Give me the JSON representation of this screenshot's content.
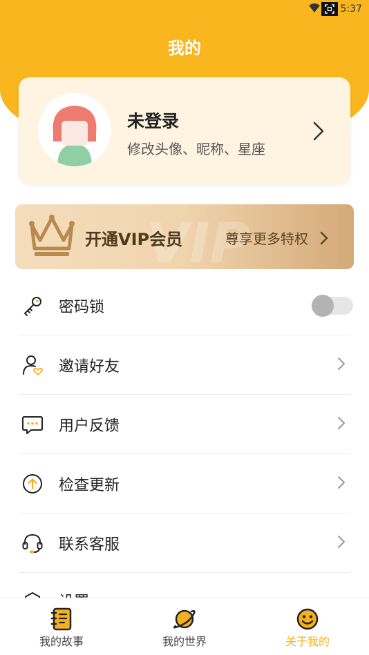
{
  "status_bar": {
    "time": "5:37",
    "icons": [
      "wifi-icon",
      "screenshot-icon"
    ]
  },
  "header": {
    "title": "我的",
    "background_color": "#FAB61E"
  },
  "profile": {
    "name": "未登录",
    "subtitle": "修改头像、昵称、星座",
    "icons": [
      "avatar-icon",
      "chevron-right-icon"
    ]
  },
  "vip": {
    "title": "开通VIP会员",
    "subtitle": "尊享更多特权",
    "watermark": "VIP",
    "icons": [
      "crown-icon",
      "chevron-right-icon"
    ]
  },
  "menu": {
    "items": [
      {
        "label": "密码锁",
        "icon": "key-icon",
        "control": "toggle",
        "toggle_on": false
      },
      {
        "label": "邀请好友",
        "icon": "invite-user-icon",
        "control": "chevron"
      },
      {
        "label": "用户反馈",
        "icon": "feedback-chat-icon",
        "control": "chevron"
      },
      {
        "label": "检查更新",
        "icon": "update-arrow-icon",
        "control": "chevron"
      },
      {
        "label": "联系客服",
        "icon": "headset-icon",
        "control": "chevron"
      },
      {
        "label": "设置",
        "icon": "settings-icon",
        "control": "chevron"
      }
    ]
  },
  "tabs": {
    "items": [
      {
        "label": "我的故事",
        "icon": "notebook-icon",
        "active": false
      },
      {
        "label": "我的世界",
        "icon": "planet-icon",
        "active": false
      },
      {
        "label": "关于我的",
        "icon": "smiley-icon",
        "active": true
      }
    ],
    "active_color": "#F5B01E"
  }
}
